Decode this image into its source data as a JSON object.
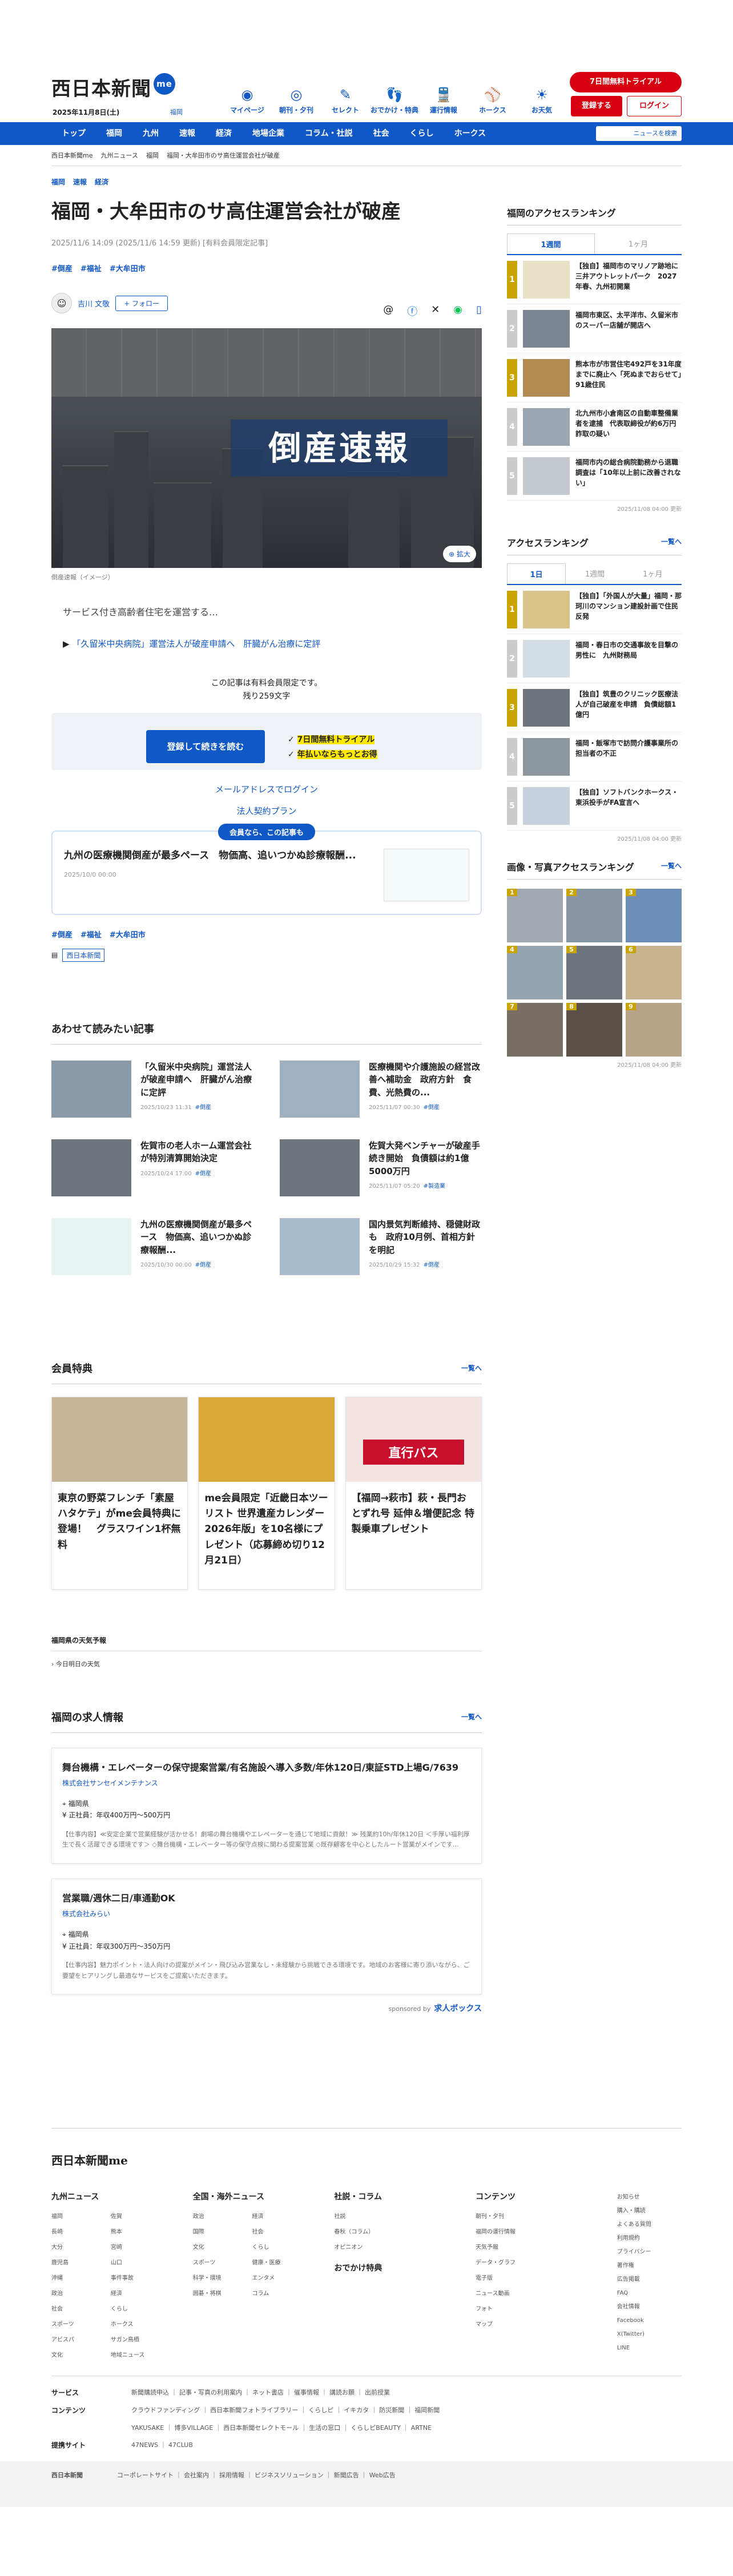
{
  "header": {
    "logo_text": "西日本新聞",
    "logo_badge": "me",
    "date": "2025年11月8日(土)",
    "region": "福岡",
    "icons": [
      {
        "label": "マイページ",
        "icon": "me-icon"
      },
      {
        "label": "朝刊・夕刊",
        "icon": "newspaper-icon"
      },
      {
        "label": "セレクト",
        "icon": "select-icon"
      },
      {
        "label": "おでかけ・特典",
        "icon": "outing-icon"
      },
      {
        "label": "運行情報",
        "icon": "train-icon"
      },
      {
        "label": "ホークス",
        "icon": "hawks-icon"
      },
      {
        "label": "お天気",
        "icon": "weather-icon"
      }
    ],
    "trial_btn": "7日間無料トライアル",
    "register_btn": "登録する",
    "login_btn": "ログイン"
  },
  "nav": {
    "items": [
      "トップ",
      "福岡",
      "九州",
      "速報",
      "経済",
      "地場企業",
      "コラム・社説",
      "社会",
      "くらし",
      "ホークス"
    ],
    "search_placeholder": "ニュースを検索"
  },
  "breadcrumb": [
    "西日本新聞me",
    "九州ニュース",
    "福岡",
    "福岡・大牟田市のサ高住運営会社が破産"
  ],
  "article": {
    "tags": [
      "福岡",
      "速報",
      "経済"
    ],
    "title": "福岡・大牟田市のサ高住運営会社が破産",
    "meta": "2025/11/6 14:09 (2025/11/6 14:59 更新) [有料会員限定記事]",
    "hashtags": [
      "#倒産",
      "#福祉",
      "#大牟田市"
    ],
    "author": "吉川 文敬",
    "follow": "+ フォロー",
    "hero_title": "倒産速報",
    "zoom": "拡大",
    "caption": "倒産速報（イメージ）",
    "lead": "サービス付き高齢者住宅を運営する…",
    "related_link": "「久留米中央病院」運営法人が破産申請へ　肝臓がん治療に定評",
    "paywall_line1": "この記事は有料会員限定です。",
    "paywall_line2": "残り259文字",
    "paywall_btn": "登録して続きを読む",
    "paywall_point1": "7日間無料トライアル",
    "paywall_point2": "年払いならもっとお得",
    "mail_login": "メールアドレスでログイン",
    "corp_plan": "法人契約プラン",
    "member_badge": "会員なら、この記事も",
    "member_title": "九州の医療機関倒産が最多ペース　物価高、追いつかぬ診療報酬...",
    "member_date": "2025/10/0 00:00",
    "bottom_tags": [
      "#倒産",
      "#福祉",
      "#大牟田市"
    ],
    "source": "西日本新聞"
  },
  "related": {
    "heading": "あわせて読みたい記事",
    "items": [
      {
        "title": "「久留米中央病院」運営法人が破産申請へ　肝臓がん治療に定評",
        "date": "2025/10/23 11:31",
        "tag": "#倒産"
      },
      {
        "title": "医療機関や介護施設の経営改善へ補助金　政府方針　食費、光熱費の...",
        "date": "2025/11/07 00:30",
        "tag": "#倒産"
      },
      {
        "title": "佐賀市の老人ホーム運営会社が特別清算開始決定",
        "date": "2025/10/24 17:00",
        "tag": "#倒産"
      },
      {
        "title": "佐賀大発ベンチャーが破産手続き開始　負債額は約1億5000万円",
        "date": "2025/11/07 05:20",
        "tag": "#製造業"
      },
      {
        "title": "九州の医療機関倒産が最多ペース　物価高、追いつかぬ診療報酬...",
        "date": "2025/10/30 00:00",
        "tag": "#倒産"
      },
      {
        "title": "国内景気判断維持、穏健財政も　政府10月例、首相方針を明記",
        "date": "2025/10/29 15:32",
        "tag": "#倒産"
      }
    ]
  },
  "perks": {
    "heading": "会員特典",
    "more": "一覧へ",
    "items": [
      "東京の野菜フレンチ「素屋ハタケテ」がme会員特典に登場！　グラスワイン1杯無料",
      "me会員限定「近畿日本ツーリスト 世界遺産カレンダー 2026年版」を10名様にプレゼント（応募締め切り12月21日）",
      "【福岡→萩市】萩・長門おとずれ号 延伸＆増便記念 特製乗車プレゼント"
    ],
    "overlay_3": "直行バス"
  },
  "weather": {
    "heading": "福岡県の天気予報",
    "item": "今日明日の天気"
  },
  "jobs": {
    "heading": "福岡の求人情報",
    "more": "一覧へ",
    "items": [
      {
        "title": "舞台機構・エレベーターの保守提案営業/有名施設へ導入多数/年休120日/東証STD上場G/7639",
        "company": "株式会社サンセイメンテナンス",
        "loc": "福岡県",
        "salary": "正社員：年収400万円〜500万円",
        "desc": "【仕事内容】≪安定企業で営業経験が活かせる！劇場の舞台機構やエレベーターを通じて地域に貢献！≫ 残業約10h/年休120日 ＜手厚い福利厚生で長く活躍できる環境です＞ ◇舞台機構・エレベーター等の保守点検に関わる提案営業 ◇既存顧客を中心としたルート営業がメインです…"
      },
      {
        "title": "営業職/週休二日/車通勤OK",
        "company": "株式会社みらい",
        "loc": "福岡県",
        "salary": "正社員：年収300万円〜350万円",
        "desc": "【仕事内容】魅力ポイント・法人向けの提案がメイン・飛び込み営業なし・未経験から挑戦できる環境です。地域のお客様に寄り添いながら、ご要望をヒアリングし最適なサービスをご提案いただきます。"
      }
    ],
    "sponsor": "sponsored by",
    "sponsor_name": "求人ボックス"
  },
  "sidebar": {
    "access_heading": "福岡のアクセスランキング",
    "access_tabs": [
      "1週間",
      "1ヶ月"
    ],
    "access_items": [
      "【独自】福岡市のマリノア跡地に三井アウトレットパーク　2027年春、九州初開業",
      "福岡市東区、太平洋市、久留米市のスーパー店舗が開店へ",
      "熊本市が市営住宅492戸を31年度までに廃止へ「死ぬまでおらせて」91歳住民",
      "北九州市小倉南区の自動車整備業者を逮捕　代表取締役が約6万円詐取の疑い",
      "福岡市内の総合病院勤務から退職　調査は「10年以上前に改善されない」"
    ],
    "access_update": "2025/11/08 04:00 更新",
    "rank_heading": "アクセスランキング",
    "rank_more": "一覧へ",
    "rank_tabs": [
      "1日",
      "1週間",
      "1ヶ月"
    ],
    "rank_items": [
      "【独自】「外国人が大量」福岡・那珂川のマンション建設計画で住民反発",
      "福岡・春日市の交通事故を目撃の男性に　九州財務局",
      "【独自】筑豊のクリニック医療法人が自己破産を申請　負債総額1億円",
      "福岡・飯塚市で訪問介護事業所の担当者の不正",
      "【独自】ソフトバンクホークス・東浜投手がFA宣言へ"
    ],
    "rank_update": "2025/11/08 04:00 更新",
    "photo_heading": "画像・写真アクセスランキング",
    "photo_more": "一覧へ",
    "photo_update": "2025/11/08 04:00 更新"
  },
  "footer": {
    "logo": "西日本新聞me",
    "cols": [
      {
        "h": "九州ニュース",
        "items": [
          "福岡",
          "佐賀",
          "長崎",
          "熊本",
          "大分",
          "宮崎",
          "鹿児島",
          "山口",
          "沖縄",
          "事件事故",
          "政治",
          "経済",
          "社会",
          "くらし",
          "スポーツ",
          "ホークス",
          "アビスパ",
          "サガン鳥栖",
          "文化",
          "地域ニュース"
        ]
      },
      {
        "h": "全国・海外ニュース",
        "items": [
          "政治",
          "経済",
          "国際",
          "社会",
          "文化",
          "くらし",
          "スポーツ",
          "健康・医療",
          "科学・環境",
          "エンタメ",
          "囲碁・将棋",
          "コラム"
        ]
      },
      {
        "h": "社説・コラム",
        "items": [
          "社説",
          "春秋（コラム）",
          "オピニオン"
        ]
      },
      {
        "h": "コンテンツ",
        "items": [
          "朝刊・夕刊",
          "福岡の運行情報",
          "天気予報",
          "データ・グラフ",
          "電子版",
          "ニュース動画",
          "フォト",
          "マップ"
        ]
      }
    ],
    "sub_heading": "おでかけ特典",
    "right": [
      "お知らせ",
      "購入・購読",
      "よくある質問",
      "利用規約",
      "プライバシー",
      "著作権",
      "広告掲載",
      "FAQ",
      "会社情報",
      "Facebook",
      "X(Twitter)",
      "LINE"
    ],
    "rows": [
      {
        "h": "サービス",
        "v": "新聞購読申込 ｜ 記事・写真の利用案内 ｜ ネット書店 ｜ 催事情報 ｜ 講読お願 ｜ 出前授業"
      },
      {
        "h": "コンテンツ",
        "v": "クラウドファンディング ｜ 西日本新聞フォトライブラリー ｜ くらしピ ｜ イキカタ ｜ 防災新聞 ｜ 福岡新聞"
      },
      {
        "h": "",
        "v": "YAKUSAKE ｜ 博多VILLAGE ｜ 西日本新聞セレクトモール ｜ 生活の窓口 ｜ くらしピBEAUTY ｜ ARTNE"
      },
      {
        "h": "提携サイト",
        "v": "47NEWS ｜ 47CLUB"
      }
    ],
    "bottom": [
      "西日本新聞",
      "コーポレートサイト ｜ 会社案内 ｜ 採用情報 ｜ ビジネスソリューション ｜ 新聞広告 ｜ Web広告"
    ]
  }
}
